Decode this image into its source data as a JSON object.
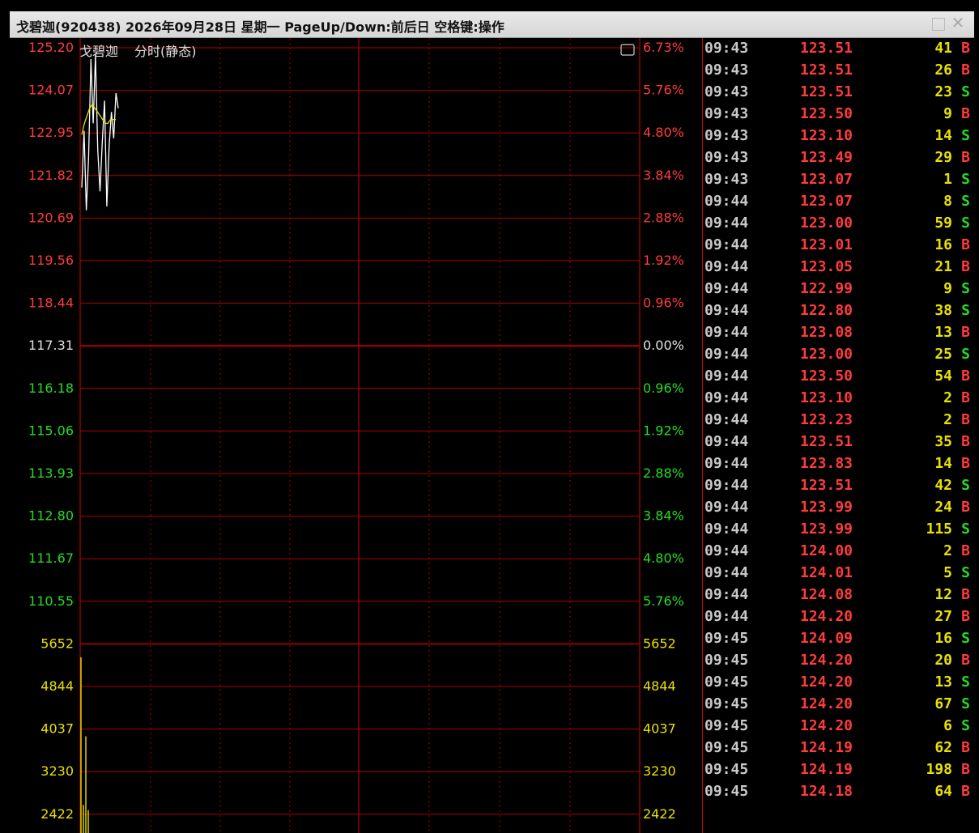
{
  "window": {
    "title": "戈碧迦(920438) 2026年09月28日 星期一 PageUp/Down:前后日 空格键:操作",
    "maximize_icon": "maximize-icon",
    "close_icon": "close-icon"
  },
  "chart_header": {
    "name": "戈碧迦",
    "mode": "分时(静态)",
    "toggle_icon": "panel-toggle-icon"
  },
  "colors": {
    "up": "#ff3b3b",
    "down": "#22dd22",
    "neutral": "#e0e0e0",
    "grid": "#b00000",
    "volume": "#e8e000",
    "avg_line": "#e8e000",
    "price_line": "#ffffff",
    "buy": "#ff3b3b",
    "sell": "#22dd22"
  },
  "chart_data": {
    "type": "line",
    "price_axis": [
      "125.20",
      "124.07",
      "122.95",
      "121.82",
      "120.69",
      "119.56",
      "118.44",
      "117.31",
      "116.18",
      "115.06",
      "113.93",
      "112.80",
      "111.67",
      "110.55"
    ],
    "pct_axis": [
      "6.73%",
      "5.76%",
      "4.80%",
      "3.84%",
      "2.88%",
      "1.92%",
      "0.96%",
      "0.00%",
      "0.96%",
      "1.92%",
      "2.88%",
      "3.84%",
      "4.80%",
      "5.76%"
    ],
    "price_axis_state": [
      "up",
      "up",
      "up",
      "up",
      "up",
      "up",
      "up",
      "neutral",
      "down",
      "down",
      "down",
      "down",
      "down",
      "down"
    ],
    "prev_close": 117.31,
    "ylim": [
      110.55,
      125.2
    ],
    "volume_axis": [
      "5652",
      "4844",
      "4037",
      "3230",
      "2422"
    ],
    "price_series": [
      121.5,
      123.0,
      120.9,
      122.3,
      124.9,
      123.2,
      125.0,
      122.5,
      121.4,
      122.7,
      123.8,
      121.0,
      122.6,
      123.5,
      122.8,
      124.0,
      123.6
    ],
    "avg_series": [
      122.9,
      123.2,
      123.4,
      123.6,
      123.7,
      123.6,
      123.5,
      123.4,
      123.3,
      123.2,
      123.2,
      123.3,
      123.3,
      123.3
    ],
    "volume_series": [
      5400,
      2600,
      3900,
      2500
    ]
  },
  "ticks": [
    {
      "time": "09:43",
      "price": "123.51",
      "vol": "41",
      "bs": "B"
    },
    {
      "time": "09:43",
      "price": "123.51",
      "vol": "26",
      "bs": "B"
    },
    {
      "time": "09:43",
      "price": "123.51",
      "vol": "23",
      "bs": "S"
    },
    {
      "time": "09:43",
      "price": "123.50",
      "vol": "9",
      "bs": "B"
    },
    {
      "time": "09:43",
      "price": "123.10",
      "vol": "14",
      "bs": "S"
    },
    {
      "time": "09:43",
      "price": "123.49",
      "vol": "29",
      "bs": "B"
    },
    {
      "time": "09:43",
      "price": "123.07",
      "vol": "1",
      "bs": "S"
    },
    {
      "time": "09:44",
      "price": "123.07",
      "vol": "8",
      "bs": "S"
    },
    {
      "time": "09:44",
      "price": "123.00",
      "vol": "59",
      "bs": "S"
    },
    {
      "time": "09:44",
      "price": "123.01",
      "vol": "16",
      "bs": "B"
    },
    {
      "time": "09:44",
      "price": "123.05",
      "vol": "21",
      "bs": "B"
    },
    {
      "time": "09:44",
      "price": "122.99",
      "vol": "9",
      "bs": "S"
    },
    {
      "time": "09:44",
      "price": "122.80",
      "vol": "38",
      "bs": "S"
    },
    {
      "time": "09:44",
      "price": "123.08",
      "vol": "13",
      "bs": "B"
    },
    {
      "time": "09:44",
      "price": "123.00",
      "vol": "25",
      "bs": "S"
    },
    {
      "time": "09:44",
      "price": "123.50",
      "vol": "54",
      "bs": "B"
    },
    {
      "time": "09:44",
      "price": "123.10",
      "vol": "2",
      "bs": "B"
    },
    {
      "time": "09:44",
      "price": "123.23",
      "vol": "2",
      "bs": "B"
    },
    {
      "time": "09:44",
      "price": "123.51",
      "vol": "35",
      "bs": "B"
    },
    {
      "time": "09:44",
      "price": "123.83",
      "vol": "14",
      "bs": "B"
    },
    {
      "time": "09:44",
      "price": "123.51",
      "vol": "42",
      "bs": "S"
    },
    {
      "time": "09:44",
      "price": "123.99",
      "vol": "24",
      "bs": "B"
    },
    {
      "time": "09:44",
      "price": "123.99",
      "vol": "115",
      "bs": "S"
    },
    {
      "time": "09:44",
      "price": "124.00",
      "vol": "2",
      "bs": "B"
    },
    {
      "time": "09:44",
      "price": "124.01",
      "vol": "5",
      "bs": "S"
    },
    {
      "time": "09:44",
      "price": "124.08",
      "vol": "12",
      "bs": "B"
    },
    {
      "time": "09:44",
      "price": "124.20",
      "vol": "27",
      "bs": "B"
    },
    {
      "time": "09:45",
      "price": "124.09",
      "vol": "16",
      "bs": "S"
    },
    {
      "time": "09:45",
      "price": "124.20",
      "vol": "20",
      "bs": "B"
    },
    {
      "time": "09:45",
      "price": "124.20",
      "vol": "13",
      "bs": "S"
    },
    {
      "time": "09:45",
      "price": "124.20",
      "vol": "67",
      "bs": "S"
    },
    {
      "time": "09:45",
      "price": "124.20",
      "vol": "6",
      "bs": "S"
    },
    {
      "time": "09:45",
      "price": "124.19",
      "vol": "62",
      "bs": "B"
    },
    {
      "time": "09:45",
      "price": "124.19",
      "vol": "198",
      "bs": "B"
    },
    {
      "time": "09:45",
      "price": "124.18",
      "vol": "64",
      "bs": "B"
    }
  ]
}
